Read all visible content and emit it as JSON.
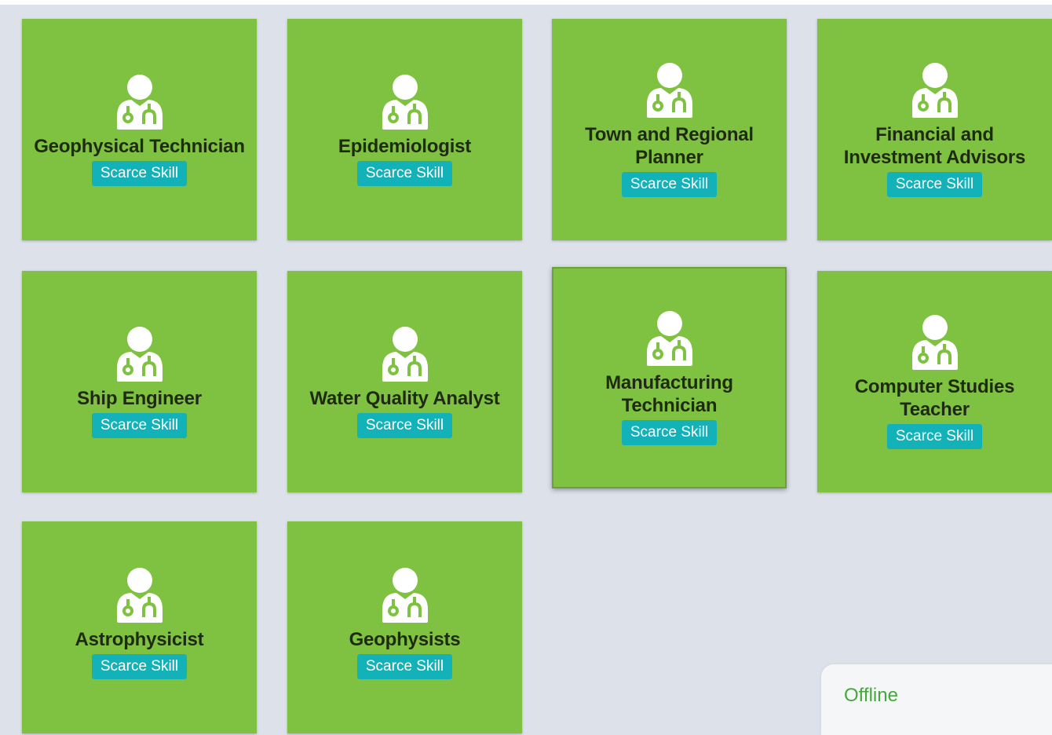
{
  "cards": [
    {
      "title": "Geophysical Technician",
      "badge": "Scarce Skill",
      "icon": "doctor-stethoscope-icon"
    },
    {
      "title": "Epidemiologist",
      "badge": "Scarce Skill",
      "icon": "doctor-stethoscope-icon"
    },
    {
      "title": "Town and Regional Planner",
      "badge": "Scarce Skill",
      "icon": "doctor-stethoscope-icon"
    },
    {
      "title": "Financial and Investment Advisors",
      "badge": "Scarce Skill",
      "icon": "doctor-stethoscope-icon"
    },
    {
      "title": "Ship Engineer",
      "badge": "Scarce Skill",
      "icon": "doctor-stethoscope-icon"
    },
    {
      "title": "Water Quality Analyst",
      "badge": "Scarce Skill",
      "icon": "doctor-stethoscope-icon"
    },
    {
      "title": "Manufacturing Technician",
      "badge": "Scarce Skill",
      "icon": "doctor-stethoscope-icon"
    },
    {
      "title": "Computer Studies Teacher",
      "badge": "Scarce Skill",
      "icon": "doctor-stethoscope-icon"
    },
    {
      "title": "Astrophysicist",
      "badge": "Scarce Skill",
      "icon": "doctor-stethoscope-icon"
    },
    {
      "title": "Geophysists",
      "badge": "Scarce Skill",
      "icon": "doctor-stethoscope-icon"
    }
  ],
  "status": {
    "label": "Offline"
  },
  "colors": {
    "background": "#dde2ea",
    "card": "#7fc242",
    "badge": "#12b2b8",
    "offline_text": "#45a83b"
  }
}
